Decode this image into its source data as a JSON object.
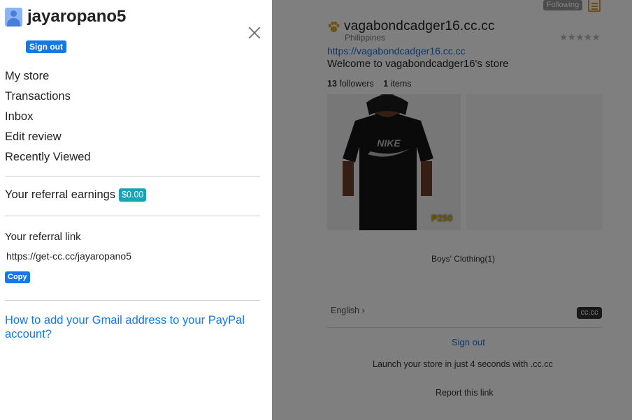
{
  "drawer": {
    "username": "jayaropano5",
    "sign_out": "Sign out",
    "menu": [
      "My store",
      "Transactions",
      "Inbox",
      "Edit review",
      "Recently Viewed"
    ],
    "referral_earnings_label": "Your referral earnings",
    "referral_earnings_value": "$0.00",
    "referral_link_label": "Your referral link",
    "referral_link": "https://get-cc.cc/jayaropano5",
    "copy_label": "Copy",
    "paypal_help": "How to add your Gmail address to your PayPal account?"
  },
  "store": {
    "following_label": "Following",
    "title": "vagabondcadger16.cc.cc",
    "country": "Philippines",
    "rating_stars": "★★★★★",
    "link": "https://vagabondcadger16.cc.cc",
    "welcome": "Welcome to vagabondcadger16's store",
    "followers_count": "13",
    "followers_label": "followers",
    "items_count": "1",
    "items_label": "items",
    "product_price": "₱250",
    "category": "Boys' Clothing(1)",
    "language": "English",
    "badge": "cc.cc",
    "sign_out": "Sign out",
    "launch_text": "Launch your store in just 4 seconds with .cc.cc",
    "report": "Report this link"
  },
  "colors": {
    "accent": "#1479e6",
    "earn_badge": "#17a2b8",
    "overlay": "rgba(0,0,0,0.5)"
  }
}
